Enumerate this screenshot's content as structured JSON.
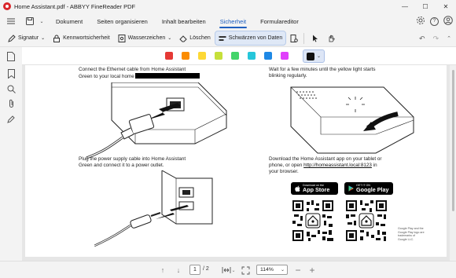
{
  "window": {
    "title": "Home Assistant.pdf - ABBYY FineReader PDF",
    "controls": {
      "minimize": "—",
      "maximize": "☐",
      "close": "✕"
    }
  },
  "menu": {
    "tabs": [
      {
        "label": "Dokument",
        "active": false
      },
      {
        "label": "Seiten organisieren",
        "active": false
      },
      {
        "label": "Inhalt bearbeiten",
        "active": false
      },
      {
        "label": "Sicherheit",
        "active": true
      },
      {
        "label": "Formulareditor",
        "active": false
      }
    ],
    "help_icon": "?"
  },
  "ribbon": {
    "signature": "Signatur",
    "password": "Kennwortsicherheit",
    "watermark": "Wasserzeichen",
    "delete": "Löschen",
    "redact": "Schwärzen von Daten"
  },
  "colors": {
    "swatches": [
      "#e53935",
      "#fb8c00",
      "#fdd835",
      "#c6e03a",
      "#43d46a",
      "#26c6da",
      "#1e88e5",
      "#e040fb"
    ],
    "selected": "#111111",
    "accent": "#1f5fbf"
  },
  "document": {
    "step1": {
      "line1": "Connect the Ethernet cable from Home Assistant",
      "line2_prefix": "Green to your local home"
    },
    "step2": {
      "line1": "Wait for a few minutes until the yellow light starts",
      "line2": "blinking regularly."
    },
    "step3": {
      "line1": "Plug the power supply cable into Home Assistant",
      "line2": "Green and connect it to a power outlet."
    },
    "step4": {
      "line1": "Download the Home Assistant app on your tablet or",
      "line2_prefix": "phone, or open ",
      "link": "http://homeassistant.local:8123",
      "line2_suffix": " in",
      "line3": "your browser."
    },
    "app_store": {
      "small": "Download on the",
      "big": "App Store"
    },
    "google_play": {
      "small": "GET IT ON",
      "big": "Google Play"
    },
    "legal": "Google Play and the Google Play logo are trademarks of Google LLC."
  },
  "navigation": {
    "current_page": "1",
    "total_pages": "/ 2",
    "zoom": "114%"
  }
}
